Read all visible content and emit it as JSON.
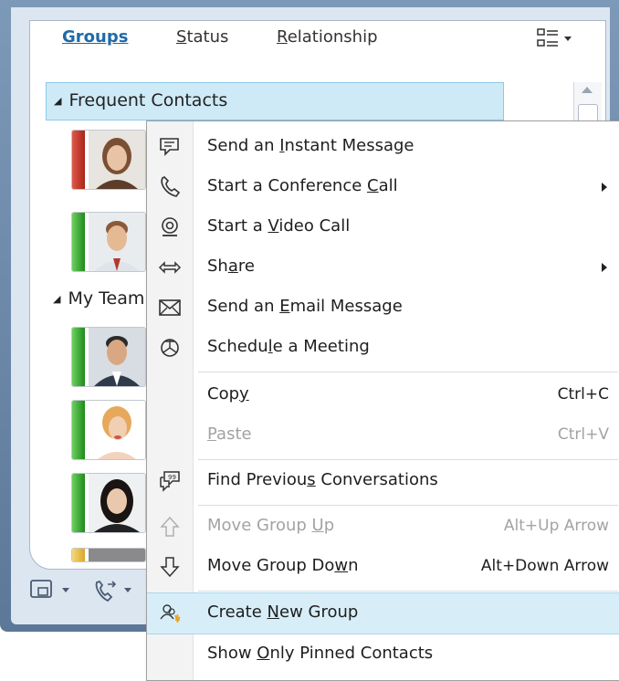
{
  "tabs": {
    "groups": "Groups",
    "status_acc": "S",
    "status_rest": "tatus",
    "relationship_acc": "R",
    "relationship_rest": "elationship"
  },
  "groups": [
    {
      "label": "Frequent Contacts",
      "selected": true
    },
    {
      "label": "My Team",
      "selected": false
    }
  ],
  "contacts": [
    {
      "presence": "busy",
      "color": "#c0392b"
    },
    {
      "presence": "available",
      "color": "#2fa52a"
    },
    {
      "presence": "available",
      "color": "#2fa52a"
    },
    {
      "presence": "available",
      "color": "#2fa52a"
    },
    {
      "presence": "available",
      "color": "#2fa52a"
    },
    {
      "presence": "away",
      "color": "#e8c14a"
    }
  ],
  "menu": {
    "items": [
      {
        "pre": "Send an ",
        "acc": "I",
        "post": "nstant Message",
        "shortcut": "",
        "submenu": false,
        "disabled": false,
        "icon": "im-icon"
      },
      {
        "pre": "Start a Conference ",
        "acc": "C",
        "post": "all",
        "shortcut": "",
        "submenu": true,
        "disabled": false,
        "icon": "phone-icon"
      },
      {
        "pre": "Start a ",
        "acc": "V",
        "post": "ideo Call",
        "shortcut": "",
        "submenu": false,
        "disabled": false,
        "icon": "video-icon"
      },
      {
        "pre": "Sh",
        "acc": "a",
        "post": "re",
        "shortcut": "",
        "submenu": true,
        "disabled": false,
        "icon": "share-icon"
      },
      {
        "pre": "Send an ",
        "acc": "E",
        "post": "mail Message",
        "shortcut": "",
        "submenu": false,
        "disabled": false,
        "icon": "email-icon"
      },
      {
        "pre": "Schedu",
        "acc": "l",
        "post": "e a Meeting",
        "shortcut": "",
        "submenu": false,
        "disabled": false,
        "icon": "meeting-icon"
      },
      {
        "pre": "Cop",
        "acc": "y",
        "post": "",
        "shortcut": "Ctrl+C",
        "submenu": false,
        "disabled": false,
        "icon": ""
      },
      {
        "pre": "",
        "acc": "P",
        "post": "aste",
        "shortcut": "Ctrl+V",
        "submenu": false,
        "disabled": true,
        "icon": ""
      },
      {
        "pre": "Find Previou",
        "acc": "s",
        "post": " Conversations",
        "shortcut": "",
        "submenu": false,
        "disabled": false,
        "icon": "conversation-history-icon"
      },
      {
        "pre": "Move Group ",
        "acc": "U",
        "post": "p",
        "shortcut": "Alt+Up Arrow",
        "submenu": false,
        "disabled": true,
        "icon": "up-arrow-icon"
      },
      {
        "pre": "Move Group Do",
        "acc": "w",
        "post": "n",
        "shortcut": "Alt+Down Arrow",
        "submenu": false,
        "disabled": false,
        "icon": "down-arrow-icon"
      },
      {
        "pre": "Create ",
        "acc": "N",
        "post": "ew Group",
        "shortcut": "",
        "submenu": false,
        "disabled": false,
        "icon": "new-group-icon",
        "hover": true
      },
      {
        "pre": "Show ",
        "acc": "O",
        "post": "nly Pinned Contacts",
        "shortcut": "",
        "submenu": false,
        "disabled": false,
        "icon": ""
      }
    ]
  },
  "colors": {
    "accent": "#1f6aa8",
    "selection": "#cfeaf7",
    "hover": "#d7eef9"
  }
}
